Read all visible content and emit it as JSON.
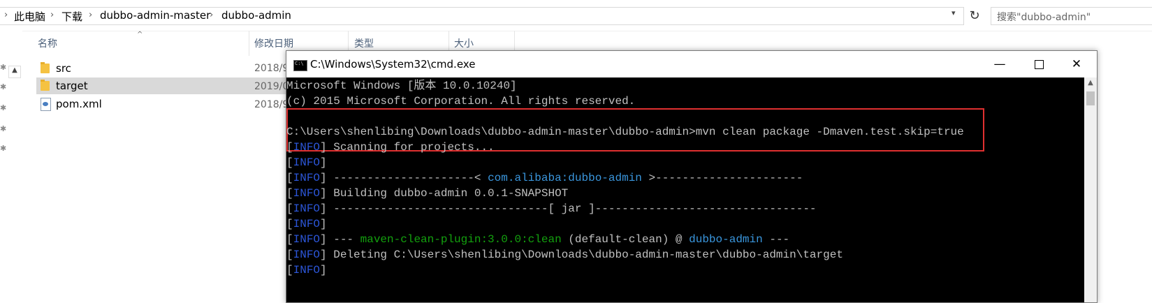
{
  "explorer": {
    "breadcrumb": [
      "此电脑",
      "下载",
      "dubbo-admin-master",
      "dubbo-admin"
    ],
    "search_placeholder": "搜索\"dubbo-admin\"",
    "columns": {
      "name": "名称",
      "date": "修改日期",
      "type": "类型",
      "size": "大小"
    },
    "files": [
      {
        "name": "src",
        "date": "2018/9",
        "kind": "folder",
        "selected": false
      },
      {
        "name": "target",
        "date": "2019/0",
        "kind": "folder",
        "selected": true
      },
      {
        "name": "pom.xml",
        "date": "2018/9",
        "kind": "xml",
        "selected": false
      }
    ]
  },
  "cmd": {
    "title": "C:\\Windows\\System32\\cmd.exe",
    "controls": {
      "minimize": "—",
      "close": "✕"
    },
    "lines": [
      {
        "segments": [
          {
            "text": "Microsoft Windows [版本 10.0.10240]",
            "color": "default"
          }
        ]
      },
      {
        "segments": [
          {
            "text": "(c) 2015 Microsoft Corporation. All rights reserved.",
            "color": "default"
          }
        ]
      },
      {
        "segments": [
          {
            "text": "",
            "color": "default"
          }
        ]
      },
      {
        "segments": [
          {
            "text": "C:\\Users\\shenlibing\\Downloads\\dubbo-admin-master\\dubbo-admin>mvn clean package -Dmaven.test.skip=true",
            "color": "default"
          }
        ]
      },
      {
        "segments": [
          {
            "text": "[",
            "color": "default"
          },
          {
            "text": "INFO",
            "color": "blue"
          },
          {
            "text": "] Scanning for projects...",
            "color": "default"
          }
        ]
      },
      {
        "segments": [
          {
            "text": "[",
            "color": "default"
          },
          {
            "text": "INFO",
            "color": "blue"
          },
          {
            "text": "]",
            "color": "default"
          }
        ]
      },
      {
        "segments": [
          {
            "text": "[",
            "color": "default"
          },
          {
            "text": "INFO",
            "color": "blue"
          },
          {
            "text": "] ---------------------< ",
            "color": "default"
          },
          {
            "text": "com.alibaba:dubbo-admin",
            "color": "cyan"
          },
          {
            "text": " >----------------------",
            "color": "default"
          }
        ]
      },
      {
        "segments": [
          {
            "text": "[",
            "color": "default"
          },
          {
            "text": "INFO",
            "color": "blue"
          },
          {
            "text": "] Building dubbo-admin 0.0.1-SNAPSHOT",
            "color": "default"
          }
        ]
      },
      {
        "segments": [
          {
            "text": "[",
            "color": "default"
          },
          {
            "text": "INFO",
            "color": "blue"
          },
          {
            "text": "] --------------------------------[ jar ]---------------------------------",
            "color": "default"
          }
        ]
      },
      {
        "segments": [
          {
            "text": "[",
            "color": "default"
          },
          {
            "text": "INFO",
            "color": "blue"
          },
          {
            "text": "]",
            "color": "default"
          }
        ]
      },
      {
        "segments": [
          {
            "text": "[",
            "color": "default"
          },
          {
            "text": "INFO",
            "color": "blue"
          },
          {
            "text": "] --- ",
            "color": "default"
          },
          {
            "text": "maven-clean-plugin:3.0.0:clean",
            "color": "green"
          },
          {
            "text": " (default-clean) @ ",
            "color": "default"
          },
          {
            "text": "dubbo-admin",
            "color": "cyan"
          },
          {
            "text": " ---",
            "color": "default"
          }
        ]
      },
      {
        "segments": [
          {
            "text": "[",
            "color": "default"
          },
          {
            "text": "INFO",
            "color": "blue"
          },
          {
            "text": "] Deleting C:\\Users\\shenlibing\\Downloads\\dubbo-admin-master\\dubbo-admin\\target",
            "color": "default"
          }
        ]
      },
      {
        "segments": [
          {
            "text": "[",
            "color": "default"
          },
          {
            "text": "INFO",
            "color": "blue"
          },
          {
            "text": "]",
            "color": "default"
          }
        ]
      }
    ]
  },
  "colors": {
    "console_bg": "#000000",
    "console_text": "#c0c0c0",
    "info_blue": "#2c56d8",
    "plugin_green": "#13a10e",
    "artifact_cyan": "#3a96dd",
    "annotation_red": "#e03030"
  },
  "icons": {
    "folder": "folder-icon",
    "xml": "xml-file-icon",
    "refresh": "refresh-icon",
    "cmd": "cmd-icon",
    "maximize": "maximize-icon"
  }
}
